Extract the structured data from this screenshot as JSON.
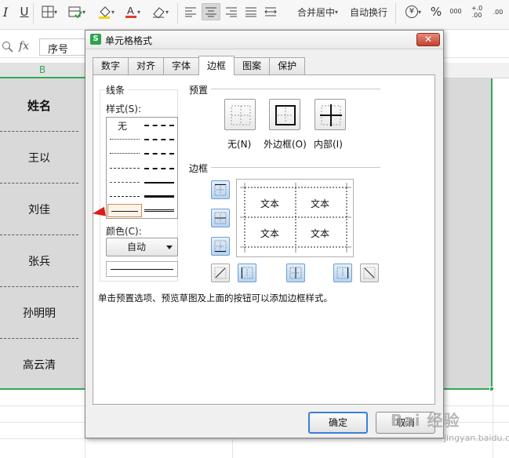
{
  "ribbon": {
    "merge_center_label": "合并居中",
    "wrap_text_label": "自动换行",
    "percent_symbol": "%",
    "increase_decimal_label": "000",
    "decimal_label": "+.0 .00",
    "currency_symbol": "¥"
  },
  "formula_bar": {
    "fx_label": "fx",
    "cell_value": "序号"
  },
  "sheet": {
    "column_header": "B",
    "cells": [
      "姓名",
      "王以",
      "刘佳",
      "张兵",
      "孙明明",
      "高云清"
    ]
  },
  "dialog": {
    "title": "单元格格式",
    "close_label": "✕",
    "tabs": [
      {
        "label": "数字"
      },
      {
        "label": "对齐"
      },
      {
        "label": "字体"
      },
      {
        "label": "边框",
        "active": true
      },
      {
        "label": "图案"
      },
      {
        "label": "保护"
      }
    ],
    "lines": {
      "group_title": "线条",
      "style_label": "样式(S):",
      "none_label": "无",
      "color_label": "颜色(C):",
      "color_value": "自动"
    },
    "presets": {
      "group_title": "预置",
      "none_label": "无(N)",
      "outline_label": "外边框(O)",
      "inside_label": "内部(I)"
    },
    "border": {
      "group_title": "边框",
      "preview_text": [
        "文本",
        "文本",
        "文本",
        "文本"
      ]
    },
    "hint": "单击预置选项、预览草图及上面的按钮可以添加边框样式。",
    "ok_label": "确定",
    "cancel_label": "取消"
  },
  "watermark": {
    "text": "Bai 经验",
    "sub": "jingyan.baidu.com"
  },
  "colors": {
    "selection_green": "#34a853",
    "close_red": "#c2422e",
    "border_button_blue": "#b7d4f2",
    "annotation_arrow": "#e01a1a"
  }
}
